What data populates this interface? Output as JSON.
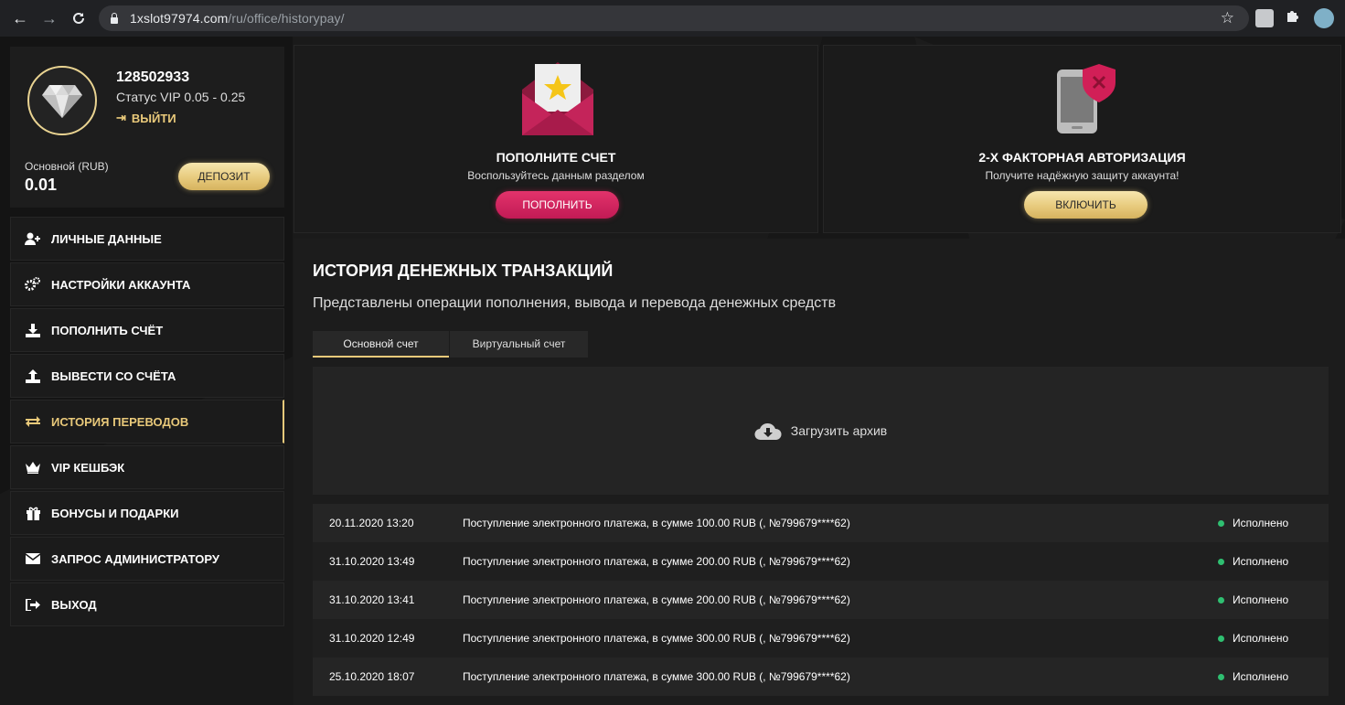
{
  "browser": {
    "url_domain": "1xslot97974.com",
    "url_path": "/ru/office/historypay/"
  },
  "profile": {
    "user_id": "128502933",
    "status": "Статус VIP 0.05 - 0.25",
    "logout_label": "ВЫЙТИ",
    "balance_label": "Основной (RUB)",
    "balance_value": "0.01",
    "deposit_label": "ДЕПОЗИТ"
  },
  "menu": {
    "items": [
      {
        "label": "ЛИЧНЫЕ ДАННЫЕ",
        "icon": "user-plus-icon"
      },
      {
        "label": "НАСТРОЙКИ АККАУНТА",
        "icon": "gears-icon"
      },
      {
        "label": "ПОПОЛНИТЬ СЧЁТ",
        "icon": "download-icon"
      },
      {
        "label": "ВЫВЕСТИ СО СЧЁТА",
        "icon": "upload-icon"
      },
      {
        "label": "ИСТОРИЯ ПЕРЕВОДОВ",
        "icon": "transfer-icon",
        "active": true
      },
      {
        "label": "VIP КЕШБЭК",
        "icon": "crown-icon"
      },
      {
        "label": "БОНУСЫ И ПОДАРКИ",
        "icon": "gift-icon"
      },
      {
        "label": "ЗАПРОС АДМИНИСТРАТОРУ",
        "icon": "envelope-icon"
      },
      {
        "label": "ВЫХОД",
        "icon": "exit-icon"
      }
    ]
  },
  "promo": {
    "deposit_card": {
      "title": "ПОПОЛНИТЕ СЧЕТ",
      "subtitle": "Воспользуйтесь данным разделом",
      "button": "ПОПОЛНИТЬ"
    },
    "twofa_card": {
      "title": "2-Х ФАКТОРНАЯ АВТОРИЗАЦИЯ",
      "subtitle": "Получите надёжную защиту аккаунта!",
      "button": "ВКЛЮЧИТЬ"
    }
  },
  "history": {
    "title": "ИСТОРИЯ ДЕНЕЖНЫХ ТРАНЗАКЦИЙ",
    "subtitle": "Представлены операции пополнения, вывода и перевода денежных средств",
    "tabs": [
      "Основной счет",
      "Виртуальный счет"
    ],
    "archive_label": "Загрузить архив",
    "rows": [
      {
        "date": "20.11.2020 13:20",
        "desc": "Поступление электронного платежа, в сумме 100.00 RUB (, №799679****62)",
        "status": "Исполнено"
      },
      {
        "date": "31.10.2020 13:49",
        "desc": "Поступление электронного платежа, в сумме 200.00 RUB (, №799679****62)",
        "status": "Исполнено"
      },
      {
        "date": "31.10.2020 13:41",
        "desc": "Поступление электронного платежа, в сумме 200.00 RUB (, №799679****62)",
        "status": "Исполнено"
      },
      {
        "date": "31.10.2020 12:49",
        "desc": "Поступление электронного платежа, в сумме 300.00 RUB (, №799679****62)",
        "status": "Исполнено"
      },
      {
        "date": "25.10.2020 18:07",
        "desc": "Поступление электронного платежа, в сумме 300.00 RUB (, №799679****62)",
        "status": "Исполнено"
      }
    ]
  },
  "colors": {
    "accent_gold": "#e9c97a",
    "accent_pink": "#c21a55",
    "status_ok": "#2fbf71"
  }
}
